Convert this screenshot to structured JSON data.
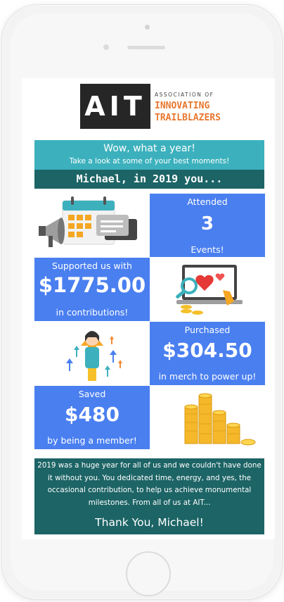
{
  "logo": {
    "mark": "AIT",
    "association": "ASSOCIATION OF",
    "line1": "INNOVATING",
    "line2": "TRAILBLAZERS"
  },
  "header": {
    "title": "Wow, what a year!",
    "subtitle": "Take a look at some of your best moments!",
    "banner": "Michael, in 2019 you..."
  },
  "stats": {
    "attended": {
      "top": "Attended",
      "value": "3",
      "bottom": "Events!"
    },
    "supported": {
      "top": "Supported us with",
      "value": "$1775.00",
      "bottom": "in contributions!"
    },
    "purchased": {
      "top": "Purchased",
      "value": "$304.50",
      "bottom": "in merch to power up!"
    },
    "saved": {
      "top": "Saved",
      "value": "$480",
      "bottom": "by being a member!"
    }
  },
  "illustrations": {
    "calendar": "calendar-megaphone-illustration",
    "laptop": "laptop-hearts-illustration",
    "person": "person-arrows-illustration",
    "coins": "coin-stacks-illustration"
  },
  "footer": {
    "message": "2019 was a huge year for all of us and we couldn't have done it without you. You dedicated time, energy, and yes, the occasional contribution, to help us achieve monumental milestones. From all of us at AIT...",
    "thanks": "Thank You, Michael!"
  },
  "colors": {
    "teal": "#3cb1bd",
    "dark_teal": "#1d6466",
    "blue": "#4a7ff0",
    "orange": "#e8772e"
  }
}
